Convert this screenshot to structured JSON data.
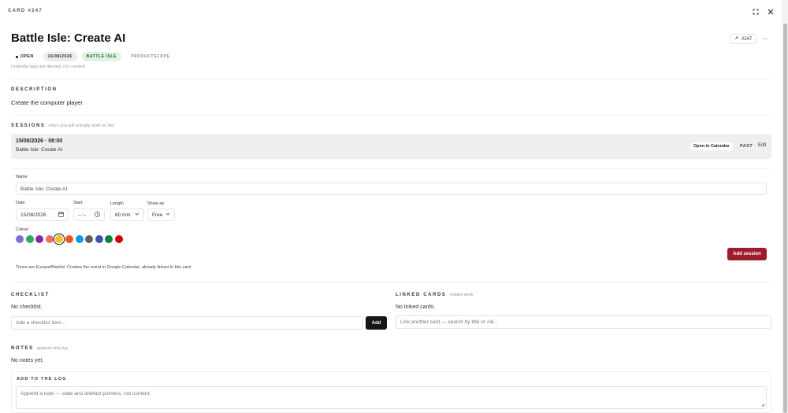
{
  "header": {
    "card_label": "CARD #247",
    "card_id": "#247"
  },
  "card": {
    "title": "Battle Isle: Create AI",
    "status": "OPEN",
    "date": "16/08/2026",
    "tags": [
      "BATTLE ISLE",
      "PRODUCTSCOPE"
    ],
    "tags_note": "Umbrella tags are derived, not curated"
  },
  "description": {
    "heading": "DESCRIPTION",
    "text": "Create the computer player"
  },
  "sessions": {
    "heading": "SESSIONS",
    "subheading": "when you will actually work on this",
    "items": [
      {
        "when": "15/08/2026 · 08:00",
        "name": "Battle Isle: Create AI",
        "calendar_button": "Open in Calendar",
        "state": "PAST",
        "edit": "Edit"
      }
    ]
  },
  "session_form": {
    "name_label": "Name",
    "name_value": "Battle Isle: Create AI",
    "date_label": "Date",
    "date_value": "15/08/2026",
    "start_label": "Start",
    "start_value": "--:--",
    "length_label": "Length",
    "length_value": "60 min",
    "show_as_label": "Show as",
    "show_as_value": "Free",
    "colour_label": "Colour",
    "colours": [
      "#7b6fd6",
      "#2eaa63",
      "#8e24aa",
      "#f06c6c",
      "#f6bf26",
      "#f4511e",
      "#039be5",
      "#616161",
      "#3f51b5",
      "#0b8043",
      "#d50000"
    ],
    "selected_colour": "#f6bf26",
    "add_button": "Add session",
    "note": "Times are Europe/Madrid. Creates the event in Google Calendar, already linked to this card."
  },
  "checklist": {
    "heading": "CHECKLIST",
    "empty": "No checklist.",
    "placeholder": "Add a checklist item...",
    "add_button": "Add"
  },
  "linked_cards": {
    "heading": "LINKED CARDS",
    "subheading": "related work",
    "empty": "No linked cards.",
    "placeholder": "Link another card — search by title or #id..."
  },
  "notes": {
    "heading": "NOTES",
    "subheading": "append-only log",
    "empty": "No notes yet.",
    "log_heading": "ADD TO THE LOG",
    "placeholder": "Append a note — state and artefact pointers, not content."
  }
}
